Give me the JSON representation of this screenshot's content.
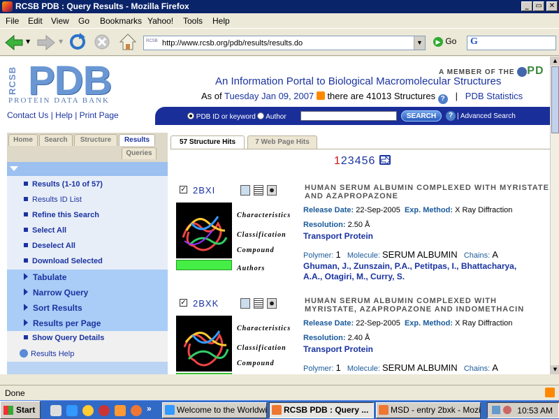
{
  "window": {
    "title": "RCSB PDB : Query Results - Mozilla Firefox",
    "controls": [
      "_",
      "▭",
      "✕"
    ]
  },
  "menu": [
    "File",
    "Edit",
    "View",
    "Go",
    "Bookmarks",
    "Yahoo!",
    "Tools",
    "Help"
  ],
  "nav": {
    "url": "http://www.rcsb.org/pdb/results/results.do",
    "url_favicon": "RCSB",
    "go_label": "Go",
    "search_brand": "G"
  },
  "header": {
    "rcsb": "RCSB",
    "logo": "PDB",
    "logo_sub": "PROTEIN DATA BANK",
    "member_prefix": "A MEMBER OF THE",
    "member_logo": "PD",
    "tagline": "An Information Portal to Biological Macromolecular Structures",
    "as_of": "As of",
    "date": "Tuesday Jan 09, 2007",
    "structures_text": "there are 41013 Structures",
    "stats_link": "PDB Statistics",
    "separator": "|",
    "links": [
      "Contact Us",
      "Help",
      "Print Page"
    ]
  },
  "search": {
    "opt1": "PDB ID or keyword",
    "opt2": "Author",
    "button": "SEARCH",
    "advanced": "| Advanced Search"
  },
  "tabs": [
    "Home",
    "Search",
    "Structure",
    "Results",
    "Queries"
  ],
  "sidebar": {
    "group1": [
      "Results (1-10 of 57)",
      "Results ID List",
      "Refine this Search",
      "Select All",
      "Deselect All",
      "Download Selected"
    ],
    "group2": [
      "Tabulate",
      "Narrow Query",
      "Sort Results",
      "Results per Page"
    ],
    "group3": [
      "Show Query Details",
      "Results Help"
    ]
  },
  "results_tabs": [
    "57 Structure Hits",
    "7 Web Page Hits"
  ],
  "pager": {
    "current": "1",
    "pages": "23456"
  },
  "labels": {
    "characteristics": "Characteristics",
    "classification": "Classification",
    "compound": "Compound",
    "authors": "Authors",
    "release_date": "Release Date:",
    "exp_method": "Exp. Method:",
    "resolution": "Resolution:",
    "polymer": "Polymer:",
    "molecule": "Molecule:",
    "chains": "Chains:"
  },
  "entries": [
    {
      "id": "2BXI",
      "title_line1": "HUMAN SERUM ALBUMIN COMPLEXED WITH MYRISTATE",
      "title_line2": "AND AZAPROPAZONE",
      "release_date": "22-Sep-2005",
      "exp_method": "X Ray Diffraction",
      "resolution": "2.50 Å",
      "classification": "Transport Protein",
      "polymer": "1",
      "molecule": "SERUM ALBUMIN",
      "chains": "A",
      "authors_line1": "Ghuman, J., Zunszain, P.A., Petitpas, I., Bhattacharya,",
      "authors_line2": "A.A., Otagiri, M., Curry, S."
    },
    {
      "id": "2BXK",
      "title_line1": "HUMAN SERUM ALBUMIN COMPLEXED WITH",
      "title_line2": "MYRISTATE, AZAPROPAZONE AND INDOMETHACIN",
      "release_date": "22-Sep-2005",
      "exp_method": "X Ray Diffraction",
      "resolution": "2.40 Å",
      "classification": "Transport Protein",
      "polymer": "1",
      "molecule": "SERUM ALBUMIN",
      "chains": "A"
    }
  ],
  "status": "Done",
  "taskbar": {
    "start": "Start",
    "quicklaunch_more": "»",
    "tasks": [
      "Welcome to the Worldwi...",
      "RCSB PDB : Query ...",
      "MSD - entry 2bxk - Mozil..."
    ],
    "clock": "10:53 AM"
  }
}
